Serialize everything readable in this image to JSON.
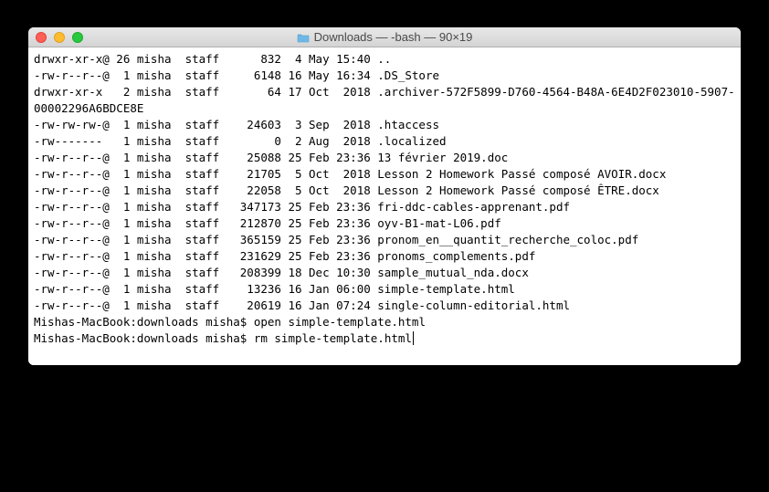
{
  "window": {
    "title": "Downloads — -bash — 90×19"
  },
  "listing": [
    {
      "perms": "drwxr-xr-x@",
      "links": "26",
      "owner": "misha",
      "group": "staff",
      "size": "832",
      "date": "4 May 15:40",
      "name": ".."
    },
    {
      "perms": "-rw-r--r--@",
      "links": "1",
      "owner": "misha",
      "group": "staff",
      "size": "6148",
      "date": "16 May 16:34",
      "name": ".DS_Store"
    },
    {
      "perms": "drwxr-xr-x",
      "links": "2",
      "owner": "misha",
      "group": "staff",
      "size": "64",
      "date": "17 Oct  2018",
      "name": ".archiver-572F5899-D760-4564-B48A-6E4D2F023010-5907-00002296A6BDCE8E"
    },
    {
      "perms": "-rw-rw-rw-@",
      "links": "1",
      "owner": "misha",
      "group": "staff",
      "size": "24603",
      "date": "3 Sep  2018",
      "name": ".htaccess"
    },
    {
      "perms": "-rw-------",
      "links": "1",
      "owner": "misha",
      "group": "staff",
      "size": "0",
      "date": "2 Aug  2018",
      "name": ".localized"
    },
    {
      "perms": "-rw-r--r--@",
      "links": "1",
      "owner": "misha",
      "group": "staff",
      "size": "25088",
      "date": "25 Feb 23:36",
      "name": "13 février 2019.doc"
    },
    {
      "perms": "-rw-r--r--@",
      "links": "1",
      "owner": "misha",
      "group": "staff",
      "size": "21705",
      "date": "5 Oct  2018",
      "name": "Lesson 2 Homework Passé composé AVOIR.docx"
    },
    {
      "perms": "-rw-r--r--@",
      "links": "1",
      "owner": "misha",
      "group": "staff",
      "size": "22058",
      "date": "5 Oct  2018",
      "name": "Lesson 2 Homework Passé composé ÊTRE.docx"
    },
    {
      "perms": "-rw-r--r--@",
      "links": "1",
      "owner": "misha",
      "group": "staff",
      "size": "347173",
      "date": "25 Feb 23:36",
      "name": "fri-ddc-cables-apprenant.pdf"
    },
    {
      "perms": "-rw-r--r--@",
      "links": "1",
      "owner": "misha",
      "group": "staff",
      "size": "212870",
      "date": "25 Feb 23:36",
      "name": "oyv-B1-mat-L06.pdf"
    },
    {
      "perms": "-rw-r--r--@",
      "links": "1",
      "owner": "misha",
      "group": "staff",
      "size": "365159",
      "date": "25 Feb 23:36",
      "name": "pronom_en__quantit_recherche_coloc.pdf"
    },
    {
      "perms": "-rw-r--r--@",
      "links": "1",
      "owner": "misha",
      "group": "staff",
      "size": "231629",
      "date": "25 Feb 23:36",
      "name": "pronoms_complements.pdf"
    },
    {
      "perms": "-rw-r--r--@",
      "links": "1",
      "owner": "misha",
      "group": "staff",
      "size": "208399",
      "date": "18 Dec 10:30",
      "name": "sample_mutual_nda.docx"
    },
    {
      "perms": "-rw-r--r--@",
      "links": "1",
      "owner": "misha",
      "group": "staff",
      "size": "13236",
      "date": "16 Jan 06:00",
      "name": "simple-template.html"
    },
    {
      "perms": "-rw-r--r--@",
      "links": "1",
      "owner": "misha",
      "group": "staff",
      "size": "20619",
      "date": "16 Jan 07:24",
      "name": "single-column-editorial.html"
    }
  ],
  "prompts": [
    {
      "prompt": "Mishas-MacBook:downloads misha$ ",
      "command": "open simple-template.html"
    },
    {
      "prompt": "Mishas-MacBook:downloads misha$ ",
      "command": "rm simple-template.html"
    }
  ]
}
